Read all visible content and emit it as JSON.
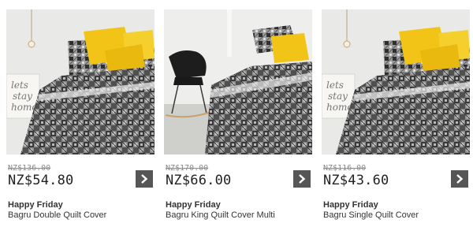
{
  "products": [
    {
      "image_alt": "Bagru Double Quilt Cover",
      "old_price": "NZ$136.00",
      "price": "NZ$54.80",
      "promo": "Happy Friday",
      "name": "Bagru Double Quilt Cover",
      "action_icon": "chevron-right-icon"
    },
    {
      "image_alt": "Bagru King Quilt Cover Multi",
      "old_price": "NZ$170.00",
      "price": "NZ$66.00",
      "promo": "Happy Friday",
      "name": "Bagru King Quilt Cover Multi",
      "action_icon": "chevron-right-icon"
    },
    {
      "image_alt": "Bagru Single Quilt Cover",
      "old_price": "NZ$116.00",
      "price": "NZ$43.60",
      "promo": "Happy Friday",
      "name": "Bagru Single Quilt Cover",
      "action_icon": "chevron-right-icon"
    }
  ],
  "art_text": [
    "lets",
    "stay",
    "home"
  ],
  "colors": {
    "accent_yellow": "#f2c418",
    "button_bg": "#565656",
    "price_text": "#222222",
    "old_price_text": "#8a8a8a"
  }
}
